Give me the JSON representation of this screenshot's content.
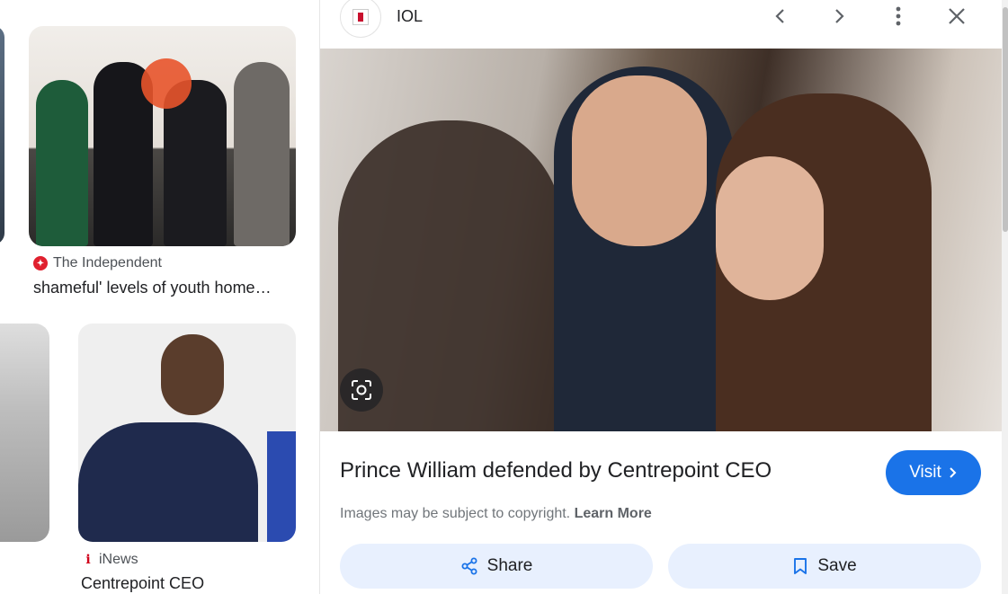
{
  "results": [
    {
      "source": "The Independent",
      "caption": "shameful' levels of youth home…"
    },
    {
      "source": "iNews",
      "caption": "Centrepoint CEO"
    }
  ],
  "preview": {
    "site_name": "IOL",
    "title": "Prince William defended by Centrepoint CEO",
    "visit_label": "Visit",
    "copyright_text": "Images may be subject to copyright.",
    "learn_more": "Learn More",
    "share_label": "Share",
    "save_label": "Save"
  },
  "icons": {
    "prev": "chevron-left-icon",
    "next": "chevron-right-icon",
    "more": "more-vert-icon",
    "close": "close-icon",
    "lens": "google-lens-icon",
    "share": "share-icon",
    "save": "bookmark-icon"
  },
  "colors": {
    "accent": "#1a73e8",
    "action_bg": "#e8f0fe",
    "independent_red": "#e0202e",
    "inews_red": "#d0021b"
  }
}
